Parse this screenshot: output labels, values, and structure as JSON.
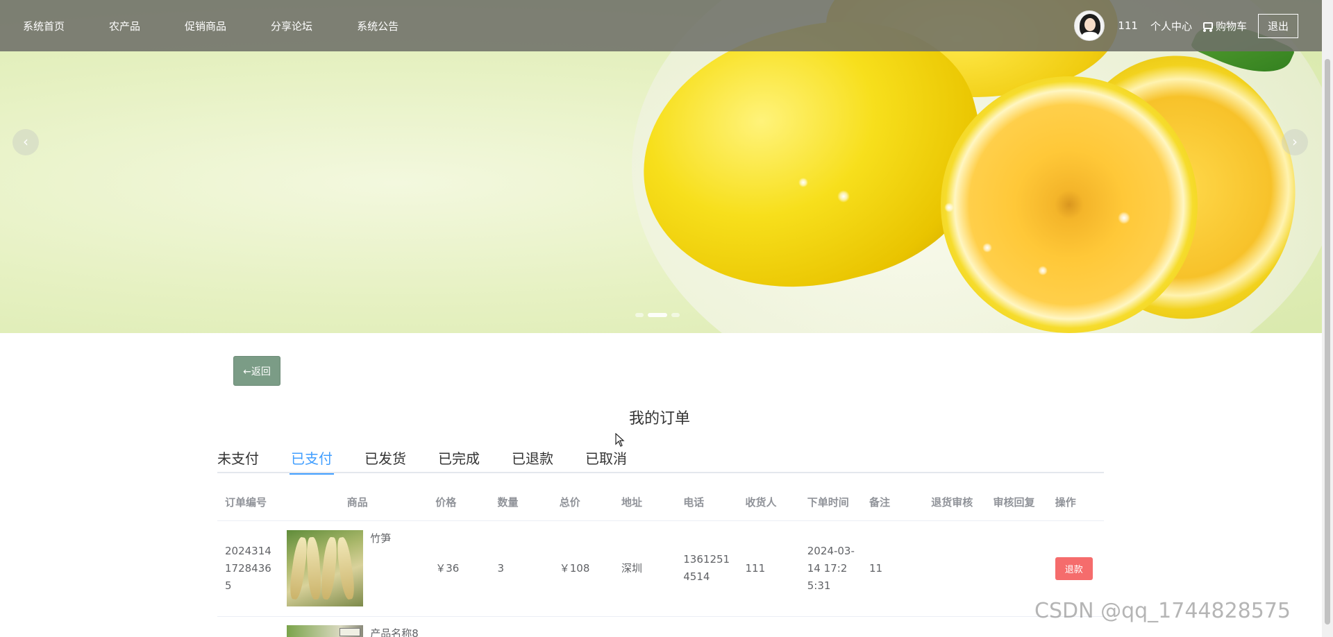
{
  "nav": {
    "items": [
      "系统首页",
      "农产品",
      "促销商品",
      "分享论坛",
      "系统公告"
    ],
    "username": "111",
    "user_center": "个人中心",
    "cart": "购物车",
    "logout": "退出",
    "cart_icon": "truck-icon"
  },
  "banner": {
    "prev_icon": "chevron-left-icon",
    "next_icon": "chevron-right-icon",
    "slides": 3,
    "active_slide": 2
  },
  "back_button": "←返回",
  "page_title": "我的订单",
  "tabs": [
    "未支付",
    "已支付",
    "已发货",
    "已完成",
    "已退款",
    "已取消"
  ],
  "active_tab": "已支付",
  "table": {
    "headers": [
      "订单编号",
      "商品",
      "价格",
      "数量",
      "总价",
      "地址",
      "电话",
      "收货人",
      "下单时间",
      "备注",
      "退货审核",
      "审核回复",
      "操作"
    ],
    "rows": [
      {
        "order_no": "202431417284365",
        "product": "竹笋",
        "price": "￥36",
        "qty": "3",
        "total": "￥108",
        "address": "深圳",
        "phone": "13612514514",
        "receiver": "111",
        "time": "2024-03-14 17:25:31",
        "note": "11",
        "review": "",
        "reply": "",
        "action": "退款"
      },
      {
        "product": "产品名称8"
      }
    ]
  },
  "watermark": "CSDN @qq_1744828575",
  "colors": {
    "accent": "#409eff",
    "refund": "#f56c6c",
    "back": "#7b9c86"
  }
}
